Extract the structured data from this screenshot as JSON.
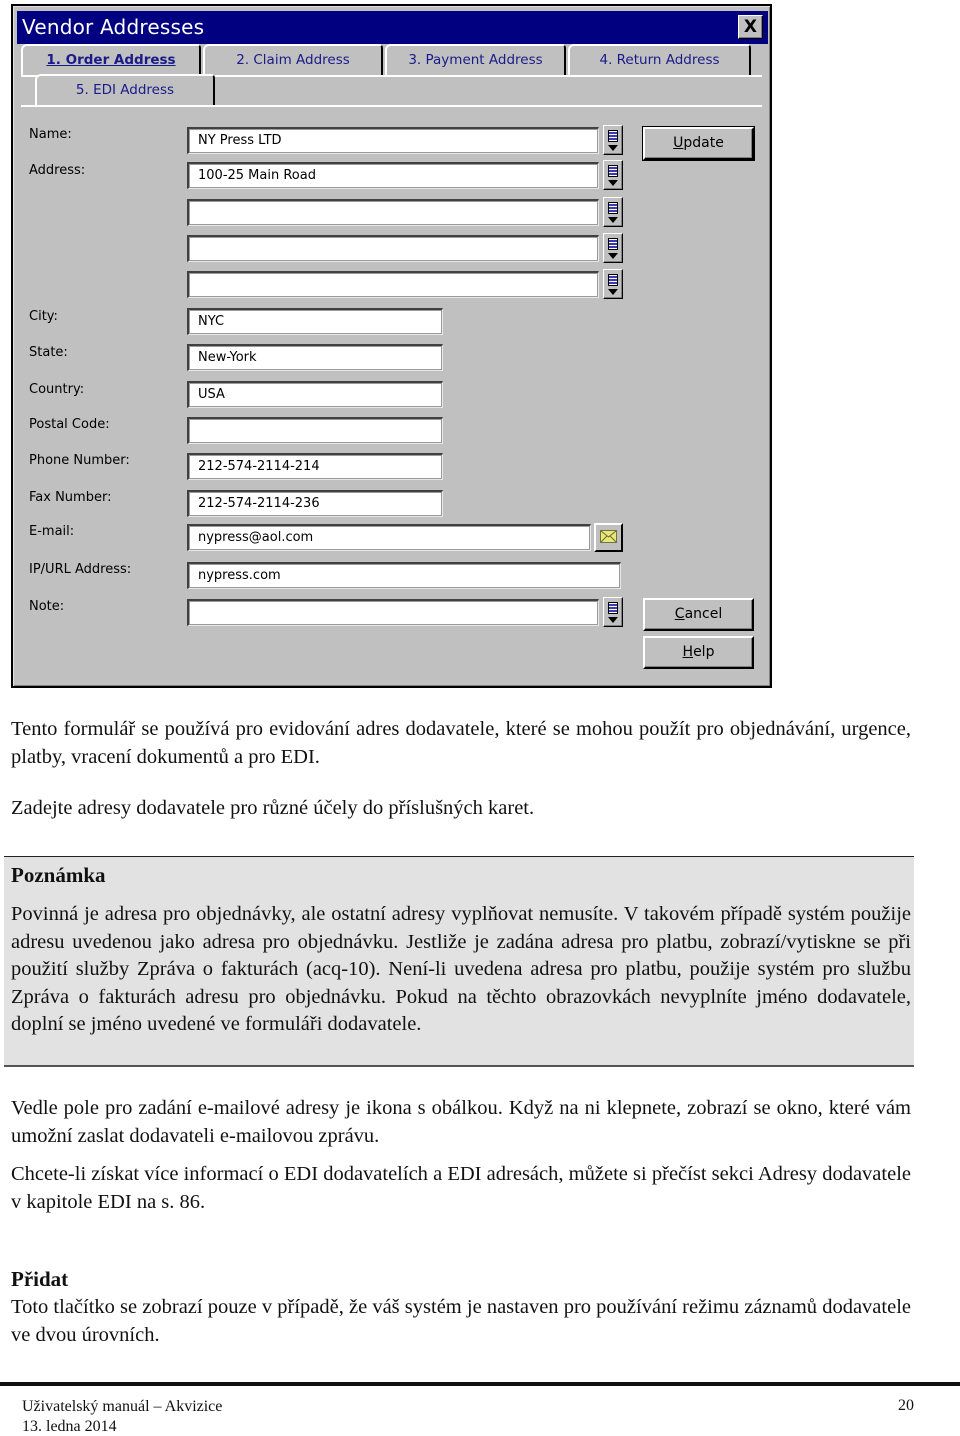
{
  "dialog": {
    "title": "Vendor Addresses",
    "close_label": "X",
    "tabs": [
      {
        "label": "1. Order Address",
        "active": true
      },
      {
        "label": "2. Claim Address",
        "active": false
      },
      {
        "label": "3. Payment Address",
        "active": false
      },
      {
        "label": "4. Return Address",
        "active": false
      },
      {
        "label": "5. EDI Address",
        "active": false
      }
    ],
    "fields": {
      "name": {
        "label": "Name:",
        "value": "NY Press LTD"
      },
      "address": {
        "label": "Address:",
        "lines": [
          "100-25 Main Road",
          "",
          "",
          ""
        ]
      },
      "city": {
        "label": "City:",
        "value": "NYC"
      },
      "state": {
        "label": "State:",
        "value": "New-York"
      },
      "country": {
        "label": "Country:",
        "value": "USA"
      },
      "postal_code": {
        "label": "Postal Code:",
        "value": ""
      },
      "phone": {
        "label": "Phone Number:",
        "value": "212-574-2114-214"
      },
      "fax": {
        "label": "Fax Number:",
        "value": "212-574-2114-236"
      },
      "email": {
        "label": "E-mail:",
        "value": "nypress@aol.com"
      },
      "url": {
        "label": "IP/URL Address:",
        "value": "nypress.com"
      },
      "note": {
        "label": "Note:",
        "value": ""
      }
    },
    "buttons": {
      "update": {
        "mnemonic": "U",
        "rest": "pdate"
      },
      "cancel": {
        "mnemonic": "C",
        "rest": "ancel"
      },
      "help": {
        "mnemonic": "H",
        "rest": "elp"
      }
    },
    "icons": {
      "lookup": "list-dropdown-icon",
      "email": "envelope-icon"
    }
  },
  "document": {
    "intro_1": "Tento formulář se používá pro evidování adres dodavatele, které se mohou použít pro objednávání, urgence, platby, vracení dokumentů a pro EDI.",
    "intro_2": "Zadejte adresy dodavatele pro různé účely do příslušných karet.",
    "note": {
      "heading": "Poznámka",
      "text": "Povinná je adresa pro objednávky, ale ostatní adresy vyplňovat nemusíte. V takovém případě systém použije adresu uvedenou jako adresa pro objednávku. Jestliže je zadána adresa pro platbu, zobrazí/vytiskne se při použití služby Zpráva o fakturách (acq-10). Není-li uvedena adresa pro platbu, použije systém pro službu Zpráva o fakturách adresu pro objednávku. Pokud na těchto obrazovkách nevyplníte jméno dodavatele, doplní se jméno uvedené ve formuláři dodavatele."
    },
    "email_para": "Vedle pole pro zadání e-mailové adresy je ikona s obálkou. Když na ni klepnete, zobrazí se okno, které vám umožní zaslat dodavateli e-mailovou zprávu.",
    "edi_para": "Chcete-li získat více informací o EDI dodavatelích a EDI adresách, můžete si přečíst sekci Adresy dodavatele v kapitole EDI na s. 86.",
    "add_section": {
      "heading": "Přidat",
      "text": "Toto tlačítko se zobrazí pouze v případě, že váš systém je nastaven pro používání režimu záznamů dodavatele ve dvou úrovních."
    }
  },
  "footer": {
    "title": "Uživatelský manuál – Akvizice",
    "date": "13. ledna 2014",
    "page_number": "20"
  }
}
